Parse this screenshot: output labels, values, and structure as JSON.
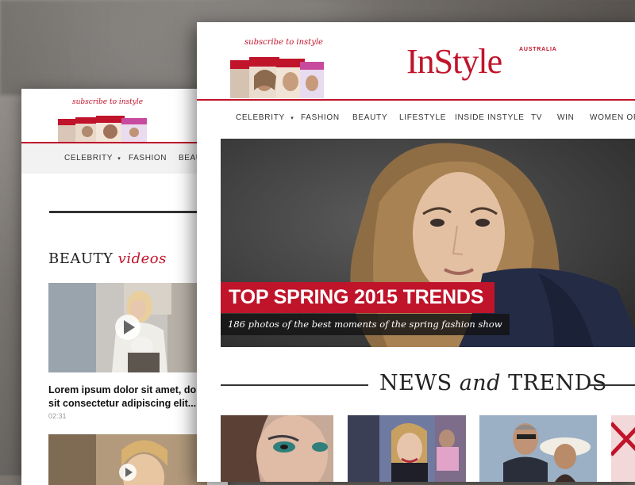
{
  "back_screen": {
    "subscribe_text": "subscribe to instyle",
    "nav": [
      "CELEBRITY",
      "FASHION",
      "BEAU"
    ],
    "section_title_main": "BEAUTY",
    "section_title_em": "videos",
    "video": {
      "caption": "Lorem ipsum dolor sit amet, dolor sit consectetur adipiscing elit...",
      "duration": "02:31"
    }
  },
  "front_screen": {
    "subscribe_text": "subscribe to instyle",
    "logo": "InStyle",
    "logo_sub": "AUSTRALIA",
    "nav": [
      "CELEBRITY",
      "FASHION",
      "BEAUTY",
      "LIFESTYLE",
      "INSIDE INSTYLE",
      "TV",
      "WIN",
      "WOMEN OF"
    ],
    "hero": {
      "title": "TOP SPRING 2015 TRENDS",
      "subtitle": "186 photos of the best moments of the spring fashion show"
    },
    "section": {
      "title_a": "NEWS",
      "title_em": "and",
      "title_b": "TRENDS"
    }
  },
  "icons": {
    "celebrity_dropdown": "caret-down-icon",
    "video_play": "play-icon"
  },
  "colors": {
    "brand_red": "#c0142b",
    "text_dark": "#222222",
    "nav_bg_mobile": "#f2f2f2"
  }
}
